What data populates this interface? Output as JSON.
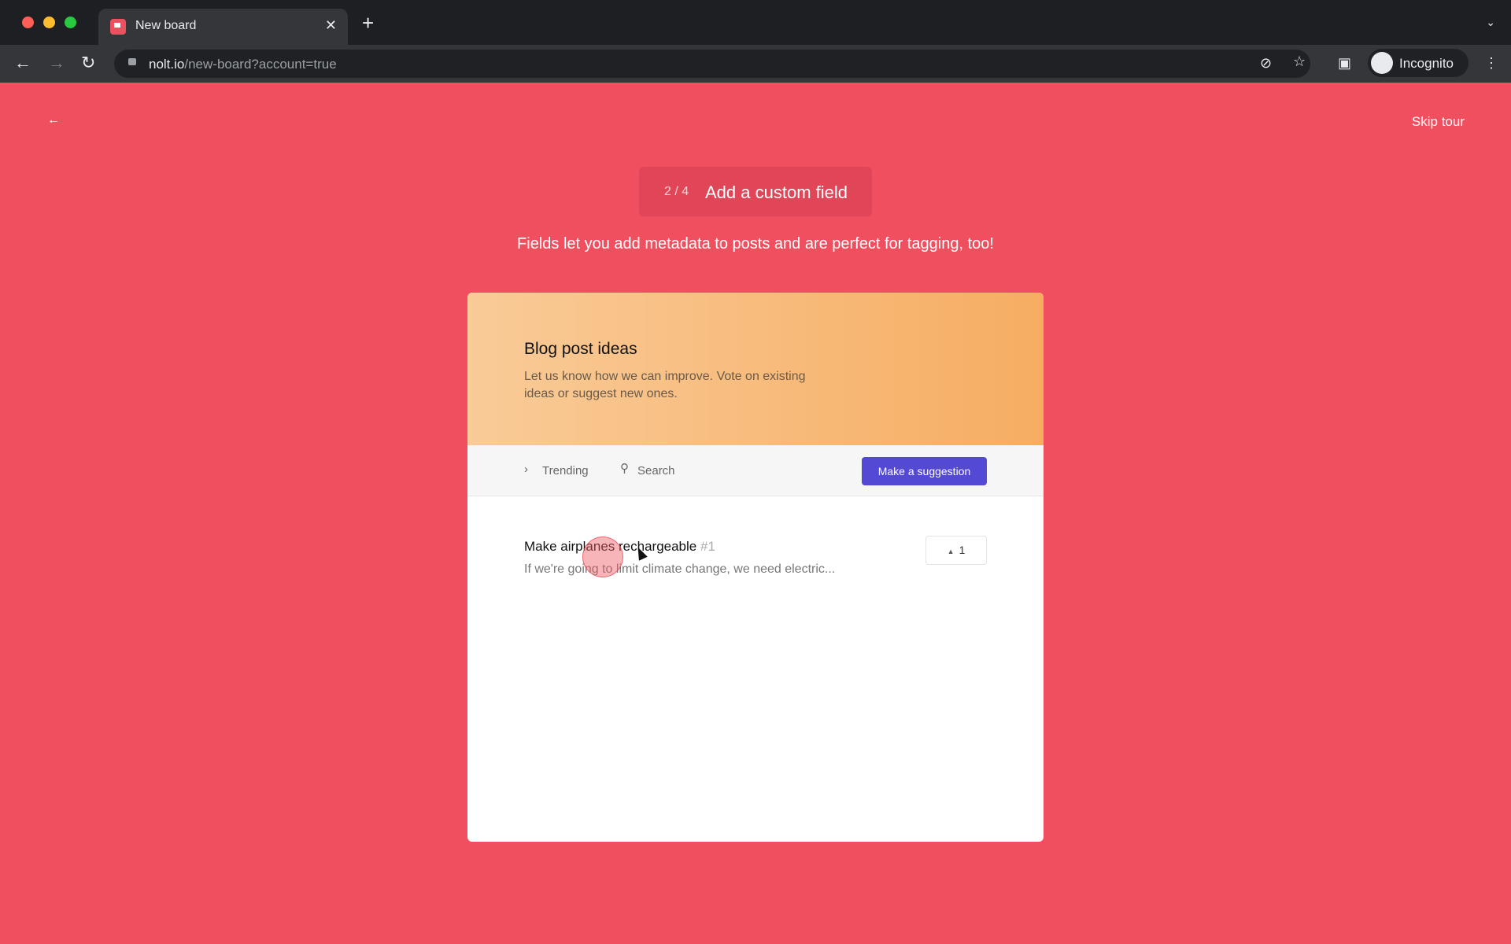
{
  "browser": {
    "tab_title": "New board",
    "url_host": "nolt.io",
    "url_path": "/new-board?account=true",
    "profile": "Incognito"
  },
  "tour": {
    "back_icon": "arrow-left",
    "skip_label": "Skip tour",
    "step": "2 / 4",
    "step_title": "Add a custom field",
    "subtitle": "Fields let you add metadata to posts and are perfect for tagging, too!"
  },
  "board": {
    "title": "Blog post ideas",
    "description": "Let us know how we can improve. Vote on existing ideas or suggest new ones.",
    "sort_label": "Trending",
    "search_label": "Search",
    "suggest_button": "Make a suggestion",
    "posts": [
      {
        "title": "Make airplanes rechargeable",
        "number": "#1",
        "excerpt": "If we're going to limit climate change, we need electric...",
        "votes": "1"
      }
    ]
  },
  "colors": {
    "background": "#ef4f5e",
    "button": "#5449d4"
  }
}
